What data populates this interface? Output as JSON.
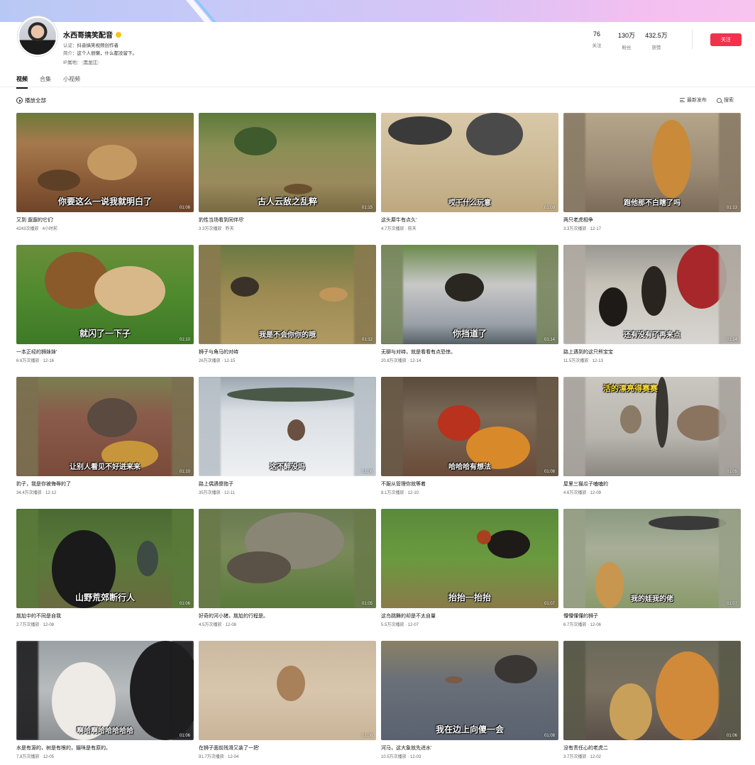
{
  "profile": {
    "name": "水西哥搞笑配音",
    "certification_label": "认证：",
    "certification": "抖音搞笑视频创作者",
    "bio_label": "简介：",
    "bio": "这个人很懒，什么都没留下。",
    "ip_label": "IP属地：",
    "ip": "黑龙江"
  },
  "stats": [
    {
      "num": "76",
      "label": "关注"
    },
    {
      "num": "130万",
      "label": "粉丝"
    },
    {
      "num": "432.5万",
      "label": "获赞"
    }
  ],
  "follow_label": "关注",
  "tabs": [
    {
      "label": "视频",
      "active": true
    },
    {
      "label": "合集",
      "active": false
    },
    {
      "label": "小视频",
      "active": false
    }
  ],
  "toolbar": {
    "play_all": "播放全部",
    "sort": "最新发布",
    "search": "搜索"
  },
  "videos": [
    {
      "title": "又到 遛遛的它们'",
      "meta": "4243次播放 · 4小时前",
      "caption": "你要这么一说我就明白了",
      "duration": "01:08"
    },
    {
      "title": "豹性当场看到同伴尽'",
      "meta": "3.3万次播放 · 昨天",
      "caption": "古人云敌之乱粹",
      "duration": "01:15"
    },
    {
      "title": "这头犀牛有点久'",
      "meta": "4.7万次播放 · 前天",
      "caption": "哎干什么玩意",
      "duration": "01:09"
    },
    {
      "title": "两只老虎相争",
      "meta": "3.3万次播放 · 12-17",
      "caption": "跑他那不白瞎了吗",
      "duration": "01:13"
    },
    {
      "title": "一本正经的狮妹妹'",
      "meta": "6.6万次播放 · 12-16",
      "caption": "就闪了一下子",
      "duration": "01:10"
    },
    {
      "title": "狮子与角马的对峙",
      "meta": "26万次播放 · 12-15",
      "caption": "我是不会你你的哦",
      "duration": "01:12"
    },
    {
      "title": "无聊与对峙，就是看看有点恐惊。",
      "meta": "20.8万次播放 · 12-14",
      "caption": "你挡道了",
      "duration": "01:14"
    },
    {
      "title": "路上遇到的这只熊宝宝",
      "meta": "11.5万次播放 · 12-13",
      "caption": "还有没有了再来点",
      "duration": "01:14"
    },
    {
      "title": "豹子，我是你被侮辱的了",
      "meta": "34.4万次播放 · 12-12",
      "caption": "让别人看见不好进来来",
      "duration": "01:10"
    },
    {
      "title": "路上偶遇傻狍子",
      "meta": "35万次播放 · 12-11",
      "caption": "这不醉没吗",
      "duration": "01:06"
    },
    {
      "title": "不服从管理你就等着",
      "meta": "8.1万次播放 · 12-10",
      "caption": "哈哈哈有想法",
      "duration": "01:08"
    },
    {
      "title": "屋里三猫瓜子嗑嗑的",
      "meta": "4.6万次播放 · 12-09",
      "caption": "活的漂亮得赛赛",
      "duration": "01:05"
    },
    {
      "title": "尴尬中的不同是自我",
      "meta": "2.7万次播放 · 12-08",
      "caption": "山野荒郊断行人",
      "duration": "01:06"
    },
    {
      "title": "好奇的河小猪，尴尬的行程是。",
      "meta": "4.5万次播放 · 12-08",
      "caption": "",
      "duration": "01:05"
    },
    {
      "title": "这鸟跳舞的却是不太自量",
      "meta": "5.5万次播放 · 12-07",
      "caption": "抬抬一抬抬",
      "duration": "01:07"
    },
    {
      "title": "懵懵懂懂的狮子",
      "meta": "6.7万次播放 · 12-06",
      "caption": "我的娃我的佬",
      "duration": "01:07"
    },
    {
      "title": "水是有源的，树是有根的，猫咪是有原的。",
      "meta": "7.8万次播放 · 12-05",
      "caption": "啊哈啊哈哈哈哈哈",
      "duration": "01:06"
    },
    {
      "title": "在狮子面前残滑又装了一把'",
      "meta": "91.7万次播放 · 12-04",
      "caption": "",
      "duration": "01:08"
    },
    {
      "title": "河马，这大象就先进水'",
      "meta": "10.5万次播放 · 12-03",
      "caption": "我在边上向傻一会",
      "duration": "01:08"
    },
    {
      "title": "没有责任心的老虎二",
      "meta": "3.7万次播放 · 12-02",
      "caption": "",
      "duration": "01:06"
    }
  ],
  "colors": {
    "accent": "#f2324d"
  }
}
